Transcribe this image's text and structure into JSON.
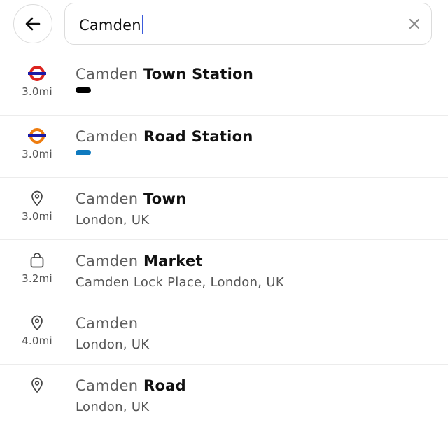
{
  "search": {
    "value": "Camden"
  },
  "icons": {
    "back": "arrow-left-icon",
    "clear": "close-icon"
  },
  "colors": {
    "underground_red": "#dc241f",
    "underground_blue": "#1a1aa6",
    "overground_orange": "#ee7c0e",
    "northern_line": "#000000",
    "overground_line": "#0f7abf",
    "caret": "#3b5bdb"
  },
  "results": [
    {
      "type": "underground",
      "icon": "underground-roundel-icon",
      "distance": "3.0mi",
      "query": "Camden",
      "rest": " Town Station",
      "subtitle": "",
      "line_color": "#000000"
    },
    {
      "type": "overground",
      "icon": "overground-roundel-icon",
      "distance": "3.0mi",
      "query": "Camden",
      "rest": " Road Station",
      "subtitle": "",
      "line_color": "#0f7abf"
    },
    {
      "type": "place",
      "icon": "location-pin-icon",
      "distance": "3.0mi",
      "query": "Camden",
      "rest": " Town",
      "subtitle": "London, UK"
    },
    {
      "type": "shop",
      "icon": "shopping-bag-icon",
      "distance": "3.2mi",
      "query": "Camden",
      "rest": " Market",
      "subtitle": "Camden Lock Place, London, UK"
    },
    {
      "type": "place",
      "icon": "location-pin-icon",
      "distance": "4.0mi",
      "query": "Camden",
      "rest": "",
      "subtitle": "London, UK"
    },
    {
      "type": "place",
      "icon": "location-pin-icon",
      "distance": "",
      "query": "Camden",
      "rest": " Road",
      "subtitle": "London, UK"
    }
  ]
}
